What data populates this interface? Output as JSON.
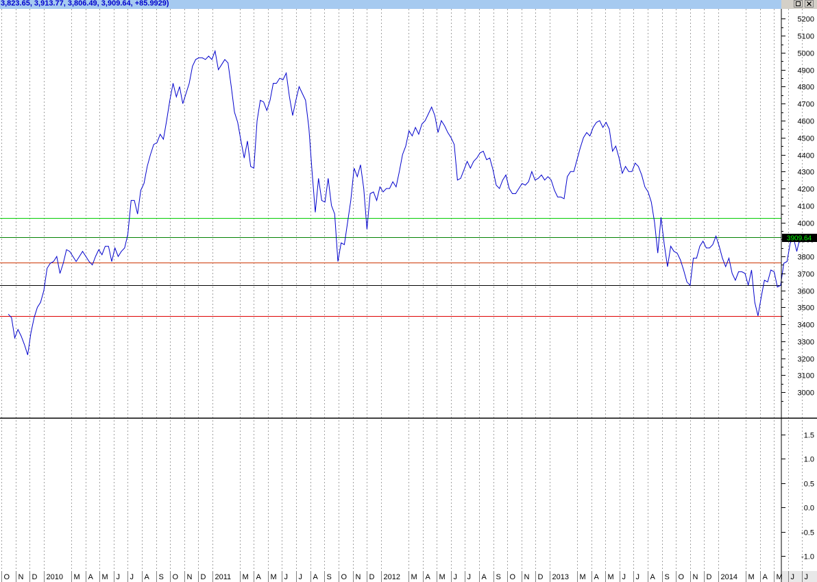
{
  "window": {
    "title": "3,823.65, 3,913.77, 3,806.49, 3,909.64, +85.9929)",
    "restore_icon": "restore-icon",
    "close_icon": "close-icon"
  },
  "chart_data": [
    {
      "type": "line",
      "panel": "price",
      "xlabel": "",
      "ylabel": "",
      "ylim": [
        2900,
        5250
      ],
      "yticks": [
        3000,
        3100,
        3200,
        3300,
        3400,
        3500,
        3600,
        3700,
        3800,
        3900,
        4000,
        4100,
        4200,
        4300,
        4400,
        4500,
        4600,
        4700,
        4800,
        4900,
        5000,
        5100,
        5200
      ],
      "grid": "vertical-dotted",
      "last_value_label": "3909.64",
      "series": [
        {
          "color": "#0000cc",
          "x_start": "2009-10-16",
          "x_step_days": 7,
          "values": [
            3460,
            3440,
            3320,
            3370,
            3330,
            3280,
            3220,
            3350,
            3440,
            3500,
            3530,
            3600,
            3730,
            3760,
            3770,
            3800,
            3700,
            3760,
            3840,
            3830,
            3800,
            3770,
            3800,
            3830,
            3800,
            3770,
            3750,
            3800,
            3840,
            3810,
            3860,
            3860,
            3770,
            3850,
            3800,
            3830,
            3850,
            3930,
            4130,
            4130,
            4050,
            4190,
            4230,
            4330,
            4400,
            4460,
            4470,
            4520,
            4490,
            4600,
            4720,
            4820,
            4740,
            4800,
            4700,
            4760,
            4820,
            4920,
            4960,
            4970,
            4970,
            4960,
            4980,
            4960,
            5010,
            4900,
            4930,
            4960,
            4940,
            4800,
            4650,
            4590,
            4480,
            4380,
            4480,
            4330,
            4320,
            4600,
            4720,
            4710,
            4660,
            4720,
            4820,
            4820,
            4850,
            4840,
            4880,
            4740,
            4630,
            4720,
            4800,
            4760,
            4720,
            4560,
            4300,
            4060,
            4260,
            4130,
            4120,
            4260,
            4100,
            4050,
            3770,
            3880,
            3870,
            4000,
            4130,
            4320,
            4270,
            4340,
            4200,
            3960,
            4170,
            4180,
            4130,
            4210,
            4180,
            4200,
            4200,
            4240,
            4210,
            4300,
            4400,
            4450,
            4540,
            4510,
            4560,
            4520,
            4580,
            4600,
            4640,
            4680,
            4630,
            4530,
            4600,
            4570,
            4530,
            4500,
            4460,
            4250,
            4260,
            4310,
            4360,
            4320,
            4360,
            4380,
            4410,
            4420,
            4370,
            4380,
            4310,
            4220,
            4200,
            4250,
            4280,
            4200,
            4170,
            4170,
            4200,
            4230,
            4220,
            4240,
            4300,
            4250,
            4260,
            4280,
            4250,
            4270,
            4250,
            4190,
            4150,
            4150,
            4140,
            4270,
            4300,
            4300,
            4370,
            4440,
            4500,
            4530,
            4510,
            4560,
            4590,
            4600,
            4560,
            4590,
            4550,
            4420,
            4450,
            4380,
            4290,
            4330,
            4300,
            4300,
            4350,
            4330,
            4280,
            4210,
            4180,
            4120,
            4000,
            3820,
            4030,
            3870,
            3740,
            3860,
            3830,
            3820,
            3780,
            3720,
            3650,
            3630,
            3790,
            3790,
            3860,
            3890,
            3850,
            3850,
            3870,
            3920,
            3860,
            3790,
            3740,
            3790,
            3700,
            3660,
            3710,
            3710,
            3700,
            3630,
            3720,
            3530,
            3450,
            3560,
            3660,
            3650,
            3720,
            3710,
            3620,
            3630,
            3760,
            3770,
            3880,
            3910,
            3830,
            3909.64
          ]
        }
      ],
      "horizontal_lines": [
        {
          "value": 4025,
          "color": "#00cc00"
        },
        {
          "value": 3915,
          "color": "#008000"
        },
        {
          "value": 3765,
          "color": "#cc3300"
        },
        {
          "value": 3630,
          "color": "#000000"
        },
        {
          "value": 3450,
          "color": "#dd0000"
        }
      ]
    },
    {
      "type": "line",
      "panel": "indicator",
      "ylim": [
        -1.29,
        1.81
      ],
      "yticks": [
        "-1.0",
        "-0.5",
        "0.0",
        "0.5",
        "1.0",
        "1.5"
      ],
      "series": []
    }
  ],
  "x_axis": {
    "labels": [
      {
        "text": "O",
        "date": "2009-10-01"
      },
      {
        "text": "N",
        "date": "2009-11-01"
      },
      {
        "text": "D",
        "date": "2009-12-01"
      },
      {
        "text": "2010",
        "date": "2010-01-01"
      },
      {
        "text": "M",
        "date": "2010-03-01"
      },
      {
        "text": "A",
        "date": "2010-04-01"
      },
      {
        "text": "M",
        "date": "2010-05-01"
      },
      {
        "text": "J",
        "date": "2010-06-01"
      },
      {
        "text": "J",
        "date": "2010-07-01"
      },
      {
        "text": "A",
        "date": "2010-08-01"
      },
      {
        "text": "S",
        "date": "2010-09-01"
      },
      {
        "text": "O",
        "date": "2010-10-01"
      },
      {
        "text": "N",
        "date": "2010-11-01"
      },
      {
        "text": "D",
        "date": "2010-12-01"
      },
      {
        "text": "2011",
        "date": "2011-01-01"
      },
      {
        "text": "M",
        "date": "2011-03-01"
      },
      {
        "text": "A",
        "date": "2011-04-01"
      },
      {
        "text": "M",
        "date": "2011-05-01"
      },
      {
        "text": "J",
        "date": "2011-06-01"
      },
      {
        "text": "J",
        "date": "2011-07-01"
      },
      {
        "text": "A",
        "date": "2011-08-01"
      },
      {
        "text": "S",
        "date": "2011-09-01"
      },
      {
        "text": "O",
        "date": "2011-10-01"
      },
      {
        "text": "N",
        "date": "2011-11-01"
      },
      {
        "text": "D",
        "date": "2011-12-01"
      },
      {
        "text": "2012",
        "date": "2012-01-01"
      },
      {
        "text": "M",
        "date": "2012-03-01"
      },
      {
        "text": "A",
        "date": "2012-04-01"
      },
      {
        "text": "M",
        "date": "2012-05-01"
      },
      {
        "text": "J",
        "date": "2012-06-01"
      },
      {
        "text": "J",
        "date": "2012-07-01"
      },
      {
        "text": "A",
        "date": "2012-08-01"
      },
      {
        "text": "S",
        "date": "2012-09-01"
      },
      {
        "text": "O",
        "date": "2012-10-01"
      },
      {
        "text": "N",
        "date": "2012-11-01"
      },
      {
        "text": "D",
        "date": "2012-12-01"
      },
      {
        "text": "2013",
        "date": "2013-01-01"
      },
      {
        "text": "M",
        "date": "2013-03-01"
      },
      {
        "text": "A",
        "date": "2013-04-01"
      },
      {
        "text": "M",
        "date": "2013-05-01"
      },
      {
        "text": "J",
        "date": "2013-06-01"
      },
      {
        "text": "J",
        "date": "2013-07-01"
      },
      {
        "text": "A",
        "date": "2013-08-01"
      },
      {
        "text": "S",
        "date": "2013-09-01"
      },
      {
        "text": "O",
        "date": "2013-10-01"
      },
      {
        "text": "N",
        "date": "2013-11-01"
      },
      {
        "text": "D",
        "date": "2013-12-01"
      },
      {
        "text": "2014",
        "date": "2014-01-01"
      },
      {
        "text": "M",
        "date": "2014-03-01"
      },
      {
        "text": "A",
        "date": "2014-04-01"
      },
      {
        "text": "M",
        "date": "2014-05-01"
      },
      {
        "text": "J",
        "date": "2014-06-01"
      },
      {
        "text": "J",
        "date": "2014-07-01"
      }
    ]
  }
}
